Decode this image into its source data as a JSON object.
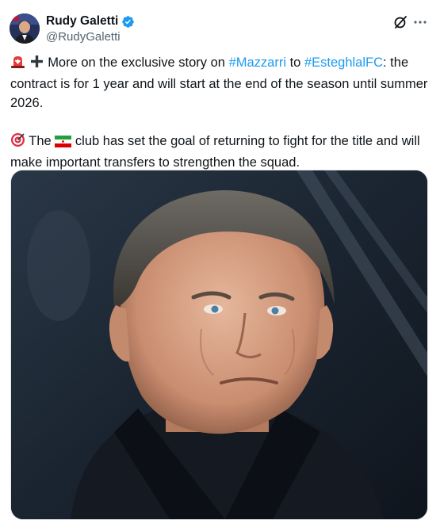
{
  "author": {
    "name": "Rudy Galetti",
    "handle": "@RudyGaletti",
    "verified": true,
    "avatar": "avatar-photo"
  },
  "header_icons": [
    "grok-icon",
    "more-options-icon"
  ],
  "tweet": {
    "line1_emojis": [
      "rotating-light-emoji",
      "plus-emoji"
    ],
    "p1_a": "More on the exclusive story on",
    "hashtag1": "#Mazzarri",
    "p1_b": "to",
    "hashtag2": "#EsteghlalFC",
    "p1_c": ": the contract is for 1 year and will start at the end of the season until summer 2026.",
    "p2_emoji": "direct-hit-emoji",
    "p2_a": "The",
    "p2_flag": "iran-flag-emoji",
    "p2_b": "club has set the goal of returning to fight for the title and will make important transfers to strengthen the squad."
  },
  "media": {
    "type": "photo",
    "subject": "portrait-photo"
  },
  "colors": {
    "text": "#0f1419",
    "secondary": "#536471",
    "link": "#1d9bf0",
    "verified": "#1d9bf0"
  }
}
